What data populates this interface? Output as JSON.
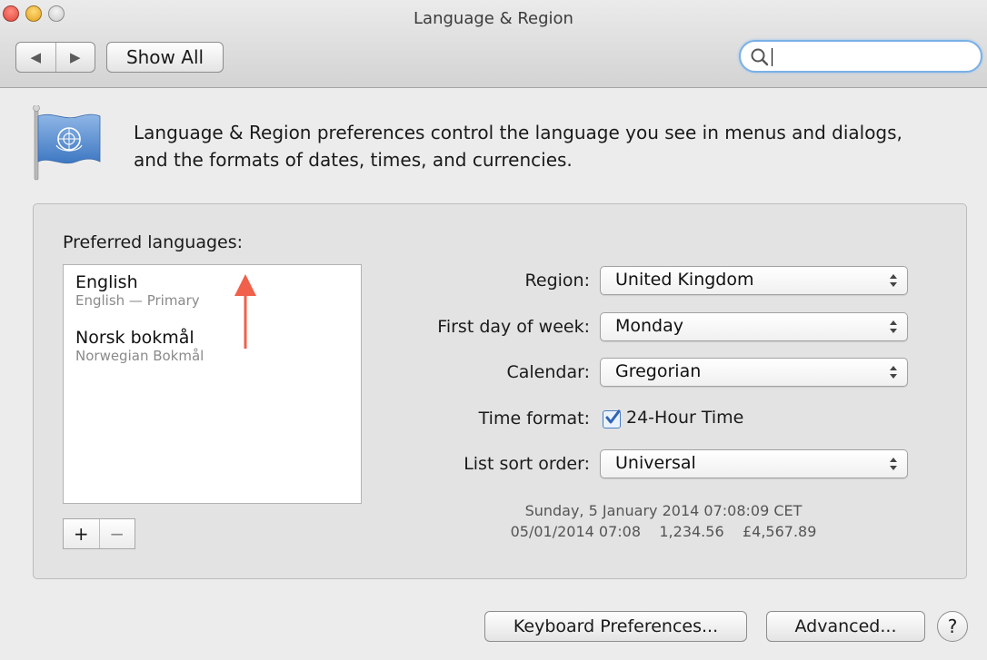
{
  "window": {
    "title": "Language & Region"
  },
  "toolbar": {
    "back_icon": "◀",
    "forward_icon": "▶",
    "show_all_label": "Show All",
    "search_value": ""
  },
  "header": {
    "description_line1": "Language & Region preferences control the language you see in menus and dialogs,",
    "description_line2": "and the formats of dates, times, and currencies."
  },
  "languages": {
    "title": "Preferred languages:",
    "items": [
      {
        "name": "English",
        "subtitle": "English — Primary"
      },
      {
        "name": "Norsk bokmål",
        "subtitle": "Norwegian Bokmål"
      }
    ],
    "add_label": "+",
    "remove_label": "−"
  },
  "settings": {
    "region_label": "Region:",
    "region_value": "United Kingdom",
    "first_day_label": "First day of week:",
    "first_day_value": "Monday",
    "calendar_label": "Calendar:",
    "calendar_value": "Gregorian",
    "time_format_label": "Time format:",
    "time_format_option": "24-Hour Time",
    "time_format_checked": true,
    "sort_order_label": "List sort order:",
    "sort_order_value": "Universal"
  },
  "sample": {
    "line1": "Sunday, 5 January 2014 07:08:09 CET",
    "line2": "05/01/2014 07:08    1,234.56    £4,567.89"
  },
  "footer": {
    "keyboard_label": "Keyboard Preferences...",
    "advanced_label": "Advanced...",
    "help_label": "?"
  },
  "colors": {
    "annotation_arrow": "#f0604a",
    "checkbox_accent": "#2f63b8"
  }
}
